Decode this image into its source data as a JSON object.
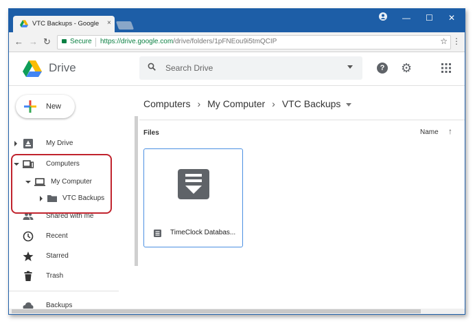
{
  "browser": {
    "tab_title": "VTC Backups - Google Dr",
    "tab_close": "×",
    "window_controls": [
      "—",
      "☐",
      "✕"
    ],
    "nav": {
      "back": "←",
      "forward": "→",
      "reload": "↻"
    },
    "secure_label": "Secure",
    "url_host": "https://drive.google.com",
    "url_path": "/drive/folders/1pFNEou9i5tmQCIP",
    "menu_glyph": "⋮",
    "bookmark_glyph": "☆",
    "accent_color": "#1d5ea7"
  },
  "header": {
    "brand": "Drive",
    "search_placeholder": "Search Drive",
    "help_glyph": "?",
    "gear_glyph": "⚙"
  },
  "sidebar": {
    "new_label": "New",
    "items": [
      {
        "label": "My Drive",
        "icon": "my-drive-icon"
      },
      {
        "label": "Computers",
        "icon": "computers-icon"
      },
      {
        "label": "My Computer",
        "icon": "laptop-icon"
      },
      {
        "label": "VTC Backups",
        "icon": "folder-icon"
      },
      {
        "label": "Shared with me",
        "icon": "people-icon"
      },
      {
        "label": "Recent",
        "icon": "clock-icon"
      },
      {
        "label": "Starred",
        "icon": "star-icon"
      },
      {
        "label": "Trash",
        "icon": "trash-icon"
      },
      {
        "label": "Backups",
        "icon": "cloud-icon"
      }
    ],
    "highlight_color": "#c0222c"
  },
  "main": {
    "breadcrumb": [
      "Computers",
      "My Computer",
      "VTC Backups"
    ],
    "breadcrumb_sep": "›",
    "files_label": "Files",
    "sort_label": "Name",
    "sort_arrow": "↑",
    "files": [
      {
        "name": "TimeClock Databas...",
        "icon": "database-file-icon"
      }
    ]
  }
}
